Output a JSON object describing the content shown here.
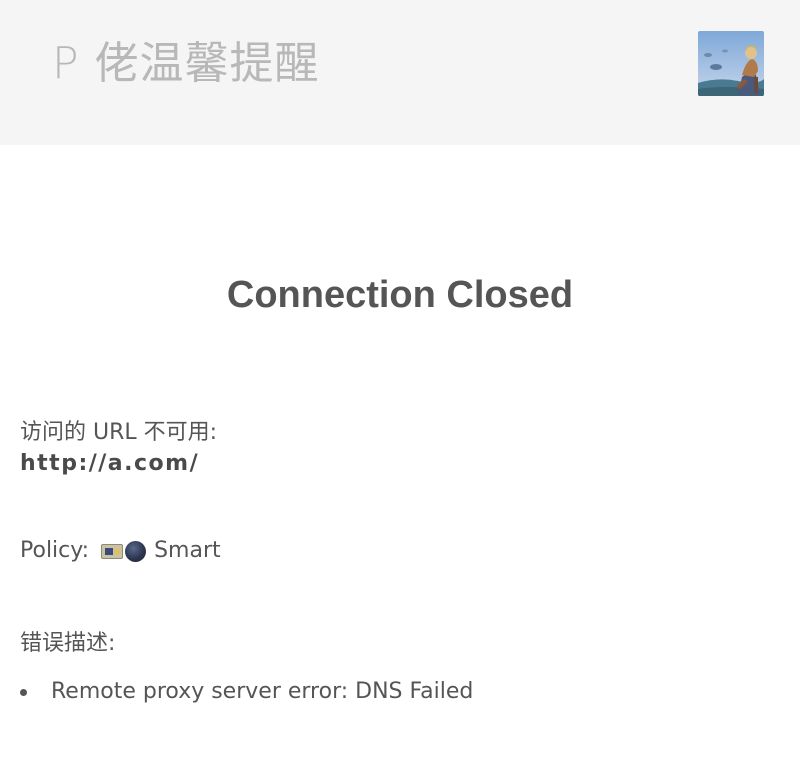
{
  "header": {
    "brand": "P 佬温馨提醒",
    "avatar_icon": "avatar-image"
  },
  "main": {
    "title": "Connection Closed",
    "url_label": "访问的 URL 不可用:",
    "url": "http://a.com/",
    "policy_label": "Policy:",
    "policy_icons": [
      "flag-icon",
      "globe-icon"
    ],
    "policy_value": "Smart",
    "error_label": "错误描述:",
    "errors": [
      "Remote proxy server error: DNS Failed"
    ]
  },
  "colors": {
    "header_bg": "#f5f5f5",
    "brand_text": "#b8b8b8",
    "body_text": "#555555"
  }
}
